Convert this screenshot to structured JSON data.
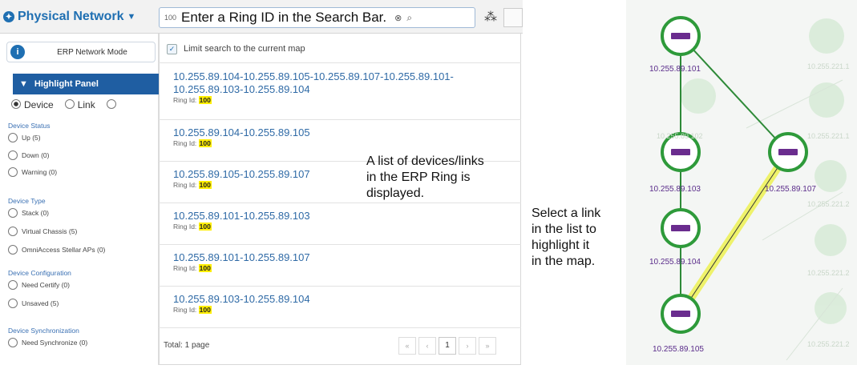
{
  "toolbar": {
    "network_selector": "Physical Network",
    "search_value": "100",
    "search_overlay_text": "Enter a Ring ID in the Search Bar."
  },
  "left_panel": {
    "erp_mode_label": "ERP Network Mode",
    "highlight_panel_label": "Highlight Panel",
    "highlight_options": [
      "Device",
      "Link"
    ],
    "sections": [
      {
        "title": "Device Status",
        "options": [
          "Up (5)",
          "Down (0)",
          "Warning (0)"
        ]
      },
      {
        "title": "Device Type",
        "options": [
          "Stack (0)",
          "Virtual Chassis (5)",
          "OmniAccess Stellar APs (0)"
        ]
      },
      {
        "title": "Device Configuration",
        "options": [
          "Need Certify (0)",
          "Unsaved (5)"
        ]
      },
      {
        "title": "Device Synchronization",
        "options": [
          "Need Synchronize (0)"
        ]
      }
    ]
  },
  "search_results": {
    "limit_label": "Limit search to the current map",
    "ring_id_label": "Ring Id: ",
    "ring_id_value": "100",
    "items": [
      {
        "line1": "10.255.89.104-10.255.89.105-10.255.89.107-10.255.89.101-",
        "line2": "10.255.89.103-10.255.89.104"
      },
      {
        "line1": "10.255.89.104-10.255.89.105",
        "line2": ""
      },
      {
        "line1": "10.255.89.105-10.255.89.107",
        "line2": ""
      },
      {
        "line1": "10.255.89.101-10.255.89.103",
        "line2": ""
      },
      {
        "line1": "10.255.89.101-10.255.89.107",
        "line2": ""
      },
      {
        "line1": "10.255.89.103-10.255.89.104",
        "line2": ""
      }
    ],
    "total_label": "Total: 1 page",
    "pager": {
      "first": "«",
      "prev": "‹",
      "current": "1",
      "next": "›",
      "last": "»"
    }
  },
  "annotations": {
    "list_note": [
      "A list of devices/links",
      "in the ERP Ring is",
      "displayed."
    ],
    "select_note": [
      "Select a link",
      "in the list to",
      "highlight it",
      "in the map."
    ]
  },
  "map": {
    "nodes": [
      "10.255.89.101",
      "10.255.89.103",
      "10.255.89.104",
      "10.255.89.105",
      "10.255.89.107"
    ],
    "faded_labels": [
      "10.255.89.102",
      "10.255.221.1",
      "10.255.221.1",
      "10.255.221.2",
      "10.255.221.2",
      "10.255.221.2"
    ],
    "node_color": "#2e9a3a",
    "device_color": "#6a2c8e",
    "highlight_color": "#eef26a"
  }
}
